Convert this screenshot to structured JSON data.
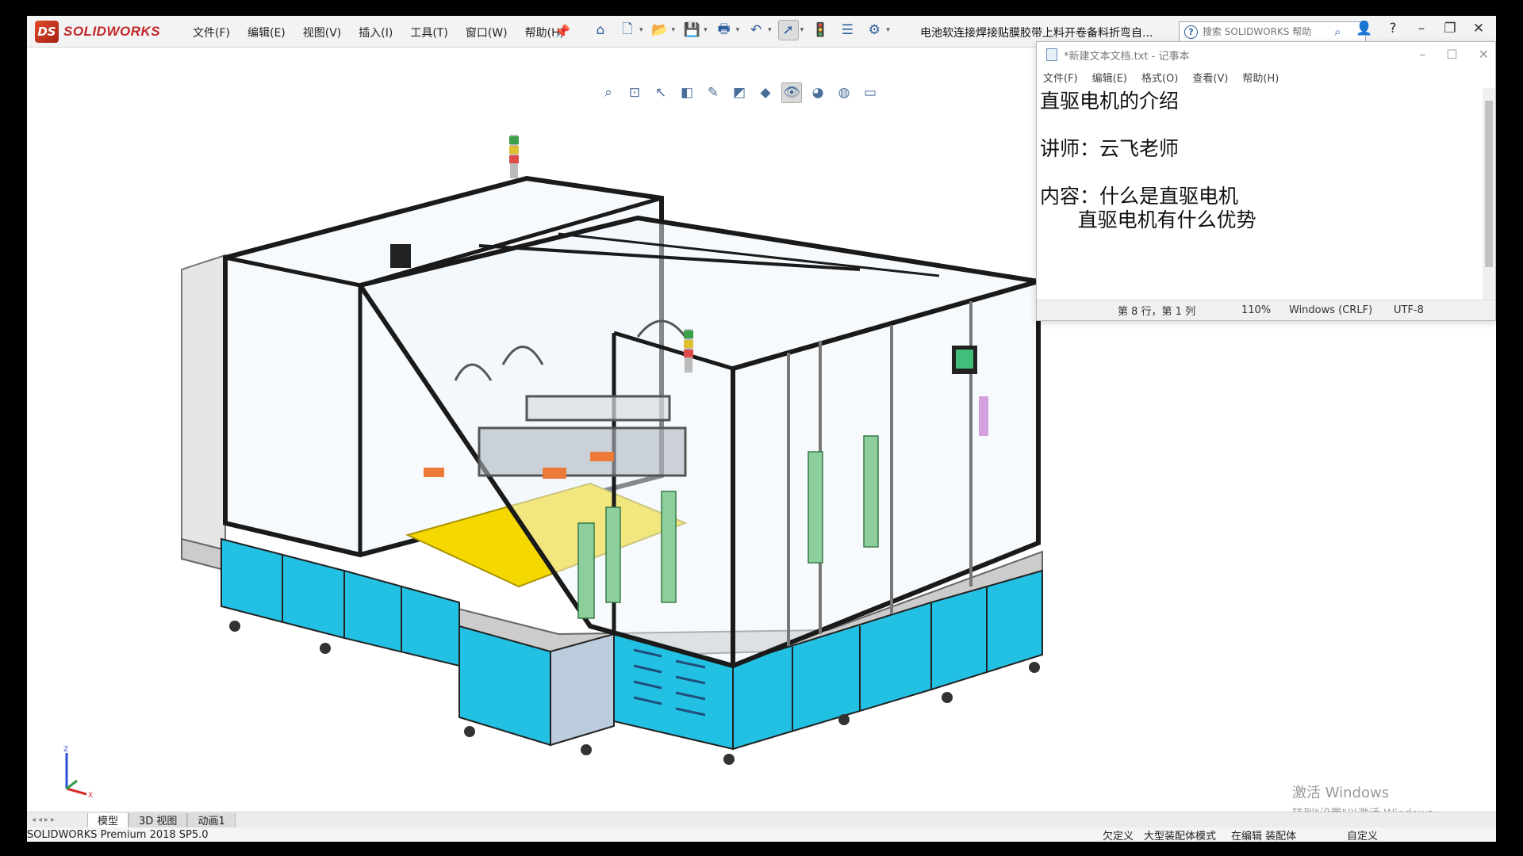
{
  "app": {
    "logo_text": "SOLIDWORKS",
    "logo_mark": "DS",
    "doc_title": "电池软连接焊接贴膜胶带上料开卷备料折弯自...",
    "search_placeholder": "搜索 SOLIDWORKS 帮助"
  },
  "menus": [
    "文件(F)",
    "编辑(E)",
    "视图(V)",
    "插入(I)",
    "工具(T)",
    "窗口(W)",
    "帮助(H)"
  ],
  "notepad": {
    "title": "*新建文本文档.txt - 记事本",
    "menus": [
      "文件(F)",
      "编辑(E)",
      "格式(O)",
      "查看(V)",
      "帮助(H)"
    ],
    "lines": [
      "直驱电机的介绍",
      "",
      "讲师：云飞老师",
      "",
      "内容：什么是直驱电机",
      "      直驱电机有什么优势",
      "",
      ""
    ],
    "status": {
      "position": "第 8 行，第 1 列",
      "zoom": "110%",
      "line_ending": "Windows (CRLF)",
      "encoding": "UTF-8"
    }
  },
  "tabs": [
    "模型",
    "3D 视图",
    "动画1"
  ],
  "status_bar": {
    "version": "SOLIDWORKS Premium 2018 SP5.0",
    "state": "欠定义",
    "mode": "大型装配体模式",
    "editing": "在编辑 装配体",
    "custom": "自定义"
  },
  "watermark": {
    "line1": "激活 Windows",
    "line2": "转到\"设置\"以激活 Windows。"
  },
  "colors": {
    "accent": "#2f5f9e",
    "cabinet": "#22c1e3",
    "frame": "#1a1a1a",
    "plate": "#f5d800",
    "support": "#8ccf9c"
  }
}
